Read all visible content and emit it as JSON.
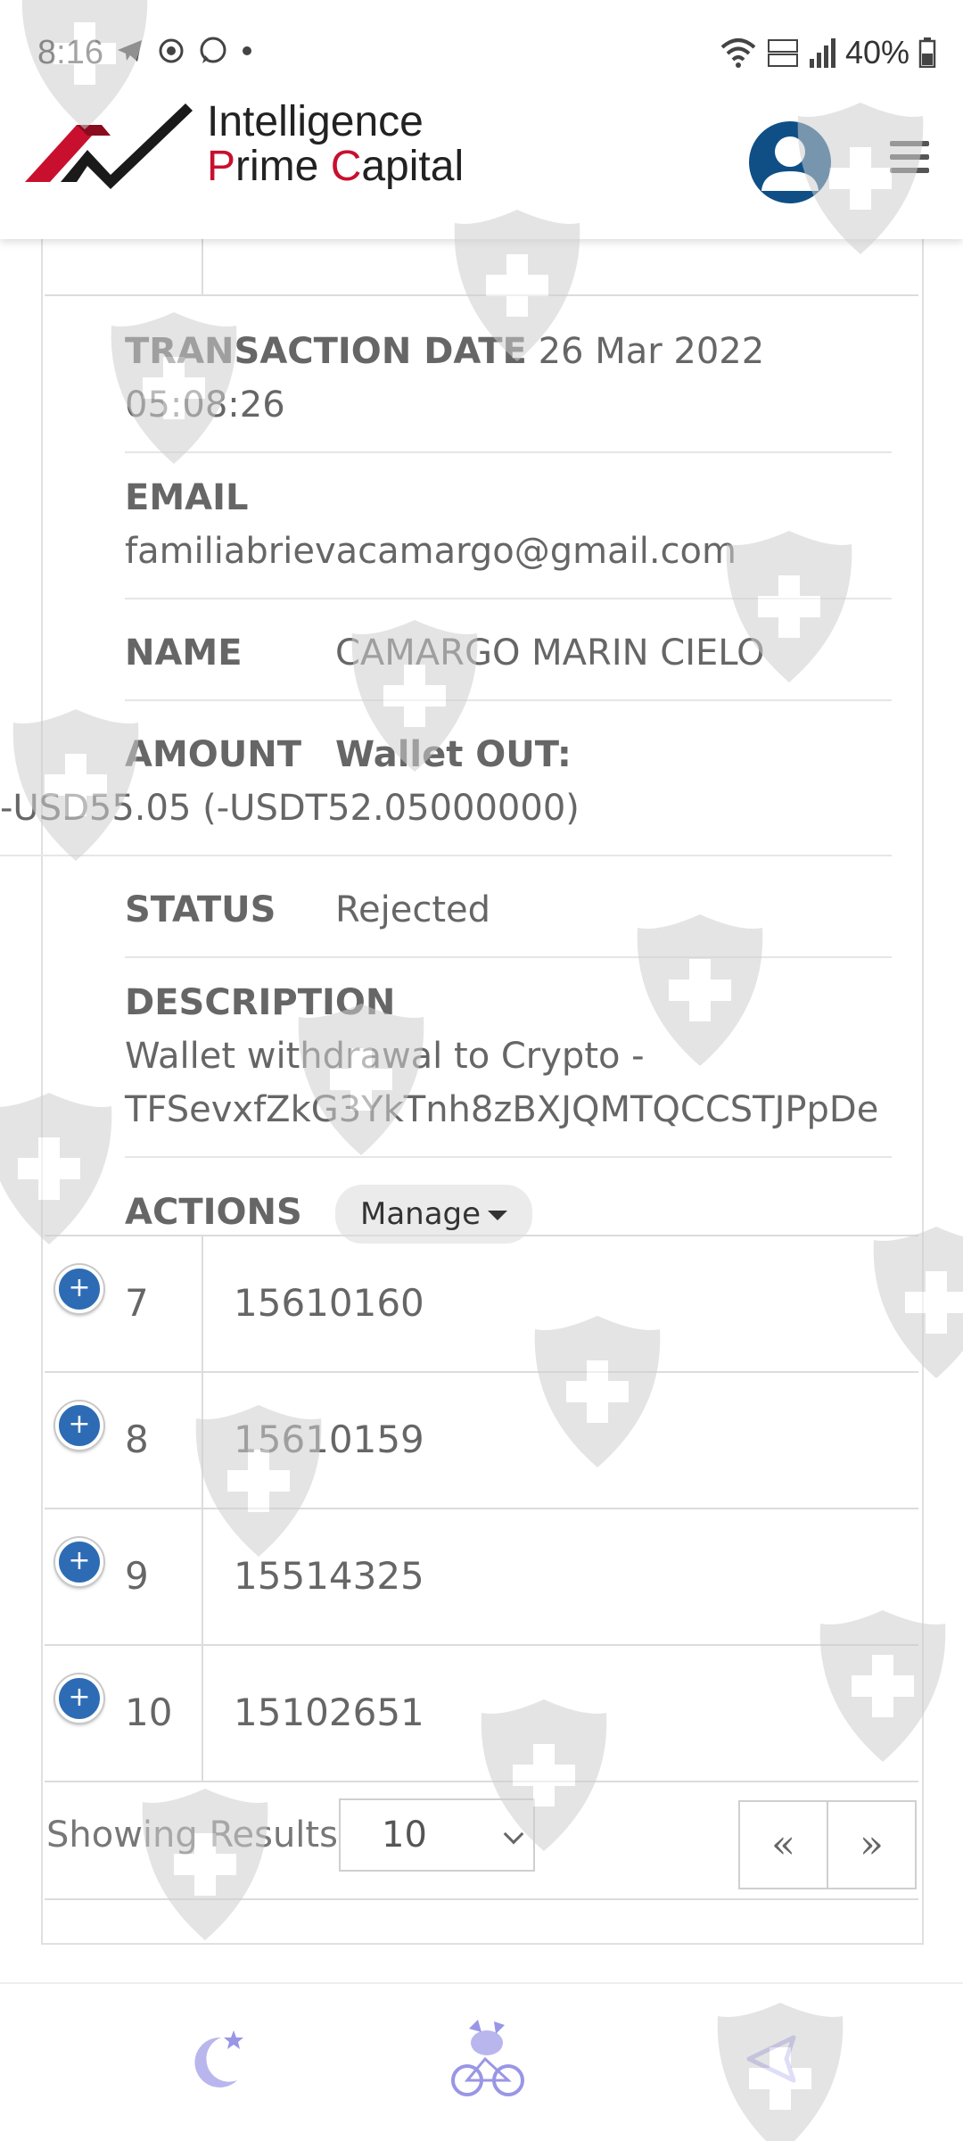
{
  "status_bar": {
    "time": "8:16",
    "battery": "40%",
    "left_icons": [
      "telegram-icon",
      "sync-icon",
      "whatsapp-icon",
      "dot-icon"
    ],
    "right_icons": [
      "wifi-icon",
      "volte-icon",
      "signal-icon",
      "battery-icon"
    ]
  },
  "header": {
    "logo_line1": "Intelligence",
    "logo_line2_p": "P",
    "logo_line2_rest1": "rime ",
    "logo_line2_c": "C",
    "logo_line2_rest2": "apital",
    "brand_color": "#c8102e",
    "avatar_color": "#0f4f86"
  },
  "details": {
    "transaction_date_label": "TRANSACTION DATE",
    "transaction_date_value": "26 Mar 2022 05:08:26",
    "email_label": "EMAIL",
    "email_value": "familiabrievacamargo@gmail.com",
    "name_label": "NAME",
    "name_value": "CAMARGO MARIN CIELO",
    "amount_label": "AMOUNT",
    "amount_type": "Wallet OUT:",
    "amount_value": "-USD55.05 (-USDT52.05000000)",
    "status_label": "STATUS",
    "status_value": "Rejected",
    "description_label": "DESCRIPTION",
    "description_line1": "Wallet withdrawal to Crypto -",
    "description_line2": "TFSevxfZkG3YkTnh8zBXJQMTQCCSTJPpDe",
    "actions_label": "ACTIONS",
    "manage_label": "Manage"
  },
  "rows": [
    {
      "num": "7",
      "id": "15610160"
    },
    {
      "num": "8",
      "id": "15610159"
    },
    {
      "num": "9",
      "id": "15514325"
    },
    {
      "num": "10",
      "id": "15102651"
    }
  ],
  "expand_symbol": "+",
  "footer": {
    "showing_label": "Showing Results",
    "page_size": "10",
    "prev_label": "«",
    "next_label": "»"
  },
  "bottom_nav": [
    "moon-star-icon",
    "cyclist-mascot-icon",
    "back-triangle-icon"
  ],
  "accent_color": "#2d6cb5"
}
